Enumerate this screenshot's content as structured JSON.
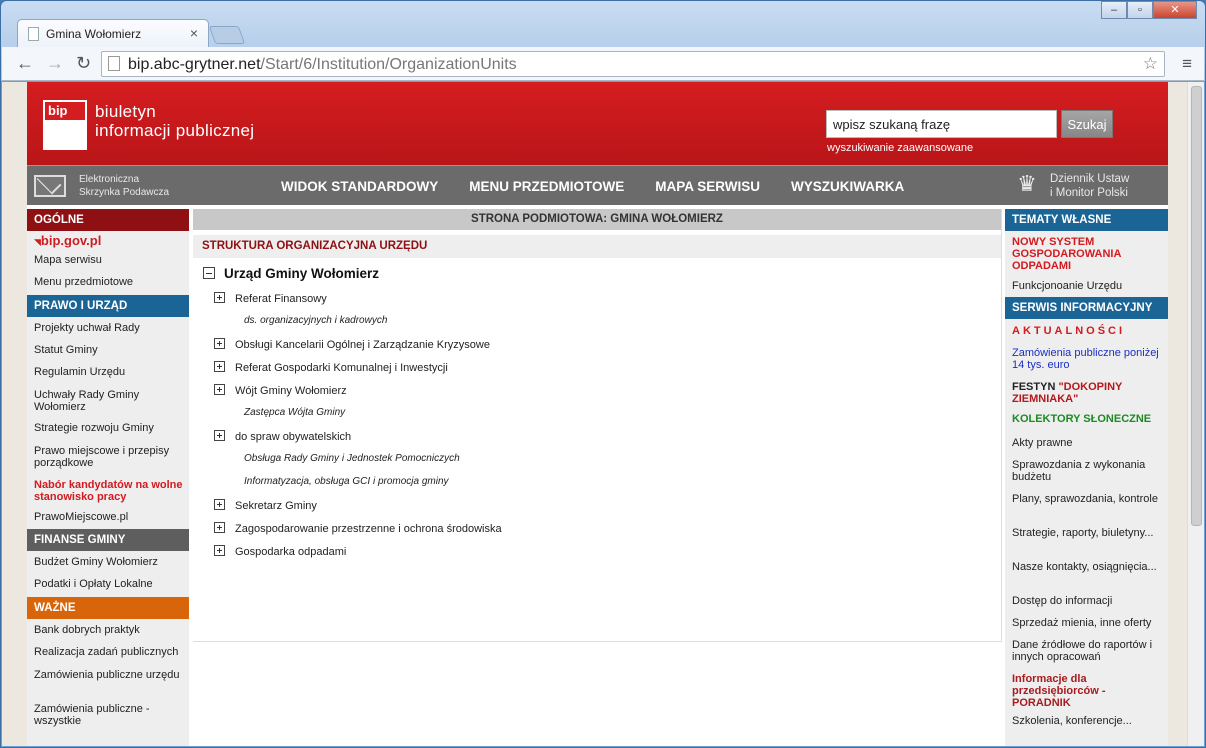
{
  "browser": {
    "tab_title": "Gmina Wołomierz",
    "tab_close": "×",
    "url_host": "bip.abc-grytner.net",
    "url_path": "/Start/6/Institution/OrganizationUnits",
    "back": "←",
    "forward": "→",
    "reload": "↻",
    "star": "☆",
    "menu": "≡",
    "win_min": "–",
    "win_max": "▫",
    "win_close": "✕"
  },
  "header": {
    "logo_text": "bip",
    "name_line1": "biuletyn",
    "name_line2": "informacji publicznej",
    "search_placeholder": "wpisz szukaną frazę",
    "search_button": "Szukaj",
    "advanced_search": "wyszukiwanie zaawansowane"
  },
  "navbar": {
    "epuap_line1": "Elektroniczna",
    "epuap_line2": "Skrzynka Podawcza",
    "items": [
      "WIDOK STANDARDOWY",
      "MENU PRZEDMIOTOWE",
      "MAPA SERWISU",
      "WYSZUKIWARKA"
    ],
    "dziennik_line1": "Dziennik Ustaw",
    "dziennik_line2": "i Monitor Polski"
  },
  "left": {
    "ogolne_head": "OGÓLNE",
    "bipgov": "bip.gov.pl",
    "ogolne": [
      "Mapa serwisu",
      "Menu przedmiotowe"
    ],
    "prawo_head": "PRAWO I URZĄD",
    "prawo": [
      "Projekty uchwał Rady",
      "Statut Gminy",
      "Regulamin Urzędu",
      "Uchwały Rady Gminy Wołomierz",
      "Strategie rozwoju Gminy",
      "Prawo miejscowe i przepisy porządkowe",
      "Nabór kandydatów na wolne stanowisko pracy",
      "PrawoMiejscowe.pl"
    ],
    "finanse_head": "FINANSE GMINY",
    "finanse": [
      "Budżet Gminy Wołomierz",
      "Podatki i Opłaty Lokalne"
    ],
    "wazne_head": "WAŻNE",
    "wazne": [
      "Bank dobrych praktyk",
      "Realizacja zadań publicznych",
      "Zamówienia publiczne urzędu",
      "Zamówienia publiczne - wszystkie"
    ]
  },
  "center": {
    "head": "STRONA PODMIOTOWA: GMINA WOŁOMIERZ",
    "sub": "STRUKTURA ORGANIZACYJNA URZĘDU",
    "root": "Urząd Gminy Wołomierz",
    "nodes": [
      "Referat Finansowy",
      "ds. organizacyjnych i kadrowych",
      "Obsługi Kancelarii Ogólnej i Zarządzanie Kryzysowe",
      "Referat Gospodarki Komunalnej i Inwestycji",
      "Wójt Gminy Wołomierz",
      "Zastępca Wójta Gminy",
      "do spraw obywatelskich",
      "Obsługa Rady Gminy i Jednostek Pomocniczych",
      "Informatyzacja, obsługa GCI i promocja gminy",
      "Sekretarz Gminy",
      "Zagospodarowanie przestrzenne i ochrona środowiska",
      "Gospodarka odpadami"
    ]
  },
  "right": {
    "tematy_head": "TEMATY WŁASNE",
    "nowy_system": "NOWY SYSTEM GOSPODAROWANIA ODPADAMI",
    "funkcjonowanie": "Funkcjonoanie Urzędu",
    "serwis_head": "SERWIS INFORMACYJNY",
    "aktualnosci": "AKTUALNOŚCI",
    "zamowienia": "Zamówienia publiczne poniżej 14 tys. euro",
    "festyn_a": "FESTYN",
    "festyn_b": "\"DOKOPINY ZIEMNIAKA\"",
    "kolektory": "KOLEKTORY SŁONECZNE",
    "items": [
      "Akty prawne",
      "Sprawozdania z wykonania budżetu",
      "Plany, sprawozdania, kontrole",
      "Strategie, raporty, biuletyny...",
      "Nasze kontakty, osiągnięcia...",
      "Dostęp do informacji",
      "Sprzedaż mienia, inne oferty",
      "Dane źródłowe do raportów i innych opracowań"
    ],
    "informacje": "Informacje dla przedsiębiorców - PORADNIK",
    "szkolenia": "Szkolenia, konferencje..."
  }
}
